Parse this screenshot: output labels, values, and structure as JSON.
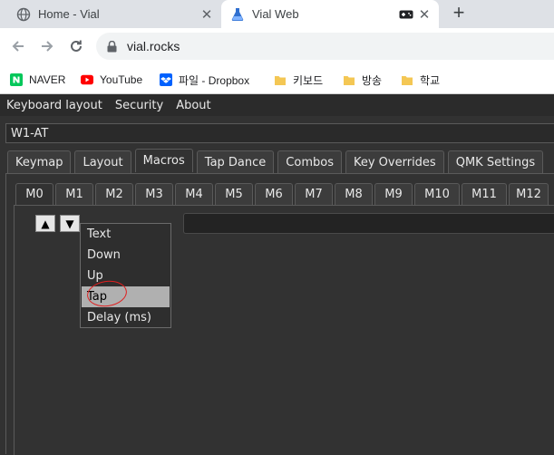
{
  "browser": {
    "tabs": [
      {
        "title": "Home - Vial",
        "active": false
      },
      {
        "title": "Vial Web",
        "active": true
      }
    ],
    "url": "vial.rocks",
    "bookmarks": [
      {
        "label": "NAVER",
        "icon": "naver-icon"
      },
      {
        "label": "YouTube",
        "icon": "youtube-icon"
      },
      {
        "label": "파일 - Dropbox",
        "icon": "dropbox-icon"
      },
      {
        "label": "키보드",
        "icon": "folder-icon"
      },
      {
        "label": "방송",
        "icon": "folder-icon"
      },
      {
        "label": "학교",
        "icon": "folder-icon"
      }
    ]
  },
  "app": {
    "menu": [
      "Keyboard layout",
      "Security",
      "About"
    ],
    "keyboard": "W1-AT",
    "tabs": [
      "Keymap",
      "Layout",
      "Macros",
      "Tap Dance",
      "Combos",
      "Key Overrides",
      "QMK Settings"
    ],
    "active_tab": "Macros",
    "macro_tabs": [
      "M0",
      "M1",
      "M2",
      "M3",
      "M4",
      "M5",
      "M6",
      "M7",
      "M8",
      "M9",
      "M10",
      "M11",
      "M12"
    ],
    "active_macro": "M0",
    "up_label": "▲",
    "down_label": "▼",
    "action_options": [
      "Text",
      "Down",
      "Up",
      "Tap",
      "Delay (ms)"
    ],
    "highlighted_option": "Tap"
  },
  "colors": {
    "app_bg": "#323232",
    "highlight": "#b0b0b0",
    "annotation": "#e01f1f"
  }
}
